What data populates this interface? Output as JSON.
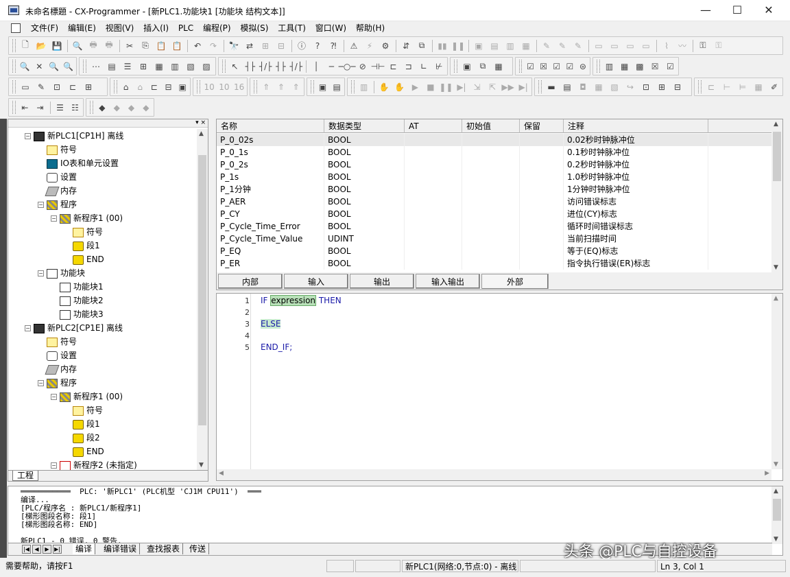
{
  "window": {
    "title": "未命名標題 - CX-Programmer - [新PLC1.功能块1 [功能块 结构文本]]",
    "minimize": "—",
    "maximize": "☐",
    "close": "✕"
  },
  "menu": [
    "文件(F)",
    "编辑(E)",
    "视图(V)",
    "插入(I)",
    "PLC",
    "编程(P)",
    "模拟(S)",
    "工具(T)",
    "窗口(W)",
    "帮助(H)"
  ],
  "mdi_controls": {
    "minimize": "–",
    "restore": "▫",
    "close": "×"
  },
  "tree": {
    "items": [
      {
        "label": "新PLC1[CP1H] 离线",
        "icon": "plc-icon",
        "level": 0,
        "expander": "−"
      },
      {
        "label": "符号",
        "icon": "symbols-icon",
        "level": 1
      },
      {
        "label": "IO表和单元设置",
        "icon": "io-table-icon",
        "level": 1
      },
      {
        "label": "设置",
        "icon": "settings-icon",
        "level": 1
      },
      {
        "label": "内存",
        "icon": "memory-icon",
        "level": 1
      },
      {
        "label": "程序",
        "icon": "programs-icon",
        "level": 1,
        "expander": "−"
      },
      {
        "label": "新程序1 (00)",
        "icon": "program-icon",
        "level": 2,
        "expander": "−"
      },
      {
        "label": "符号",
        "icon": "symbols-icon",
        "level": 3
      },
      {
        "label": "段1",
        "icon": "section-icon",
        "level": 3
      },
      {
        "label": "END",
        "icon": "section-icon",
        "level": 3
      },
      {
        "label": "功能块",
        "icon": "function-blocks-icon",
        "level": 1,
        "expander": "−"
      },
      {
        "label": "功能块1",
        "icon": "function-block-icon",
        "level": 2
      },
      {
        "label": "功能块2",
        "icon": "function-block-icon",
        "level": 2
      },
      {
        "label": "功能块3",
        "icon": "function-block-icon",
        "level": 2
      },
      {
        "label": "新PLC2[CP1E] 离线",
        "icon": "plc-icon",
        "level": 0,
        "expander": "−"
      },
      {
        "label": "符号",
        "icon": "symbols-icon",
        "level": 1
      },
      {
        "label": "设置",
        "icon": "settings-icon",
        "level": 1
      },
      {
        "label": "内存",
        "icon": "memory-icon",
        "level": 1
      },
      {
        "label": "程序",
        "icon": "programs-icon",
        "level": 1,
        "expander": "−"
      },
      {
        "label": "新程序1 (00)",
        "icon": "program-icon",
        "level": 2,
        "expander": "−"
      },
      {
        "label": "符号",
        "icon": "symbols-icon",
        "level": 3
      },
      {
        "label": "段1",
        "icon": "section-icon",
        "level": 3
      },
      {
        "label": "段2",
        "icon": "section-icon",
        "level": 3
      },
      {
        "label": "END",
        "icon": "section-icon",
        "level": 3
      },
      {
        "label": "新程序2 (未指定)",
        "icon": "program-unassigned-icon",
        "level": 2,
        "expander": "−"
      }
    ],
    "tab": "工程"
  },
  "variables": {
    "columns": [
      "名称",
      "数据类型",
      "AT",
      "初始值",
      "保留",
      "注释"
    ],
    "rows": [
      [
        "P_0_02s",
        "BOOL",
        "",
        "",
        "",
        "0.02秒时钟脉冲位"
      ],
      [
        "P_0_1s",
        "BOOL",
        "",
        "",
        "",
        "0.1秒时钟脉冲位"
      ],
      [
        "P_0_2s",
        "BOOL",
        "",
        "",
        "",
        "0.2秒时钟脉冲位"
      ],
      [
        "P_1s",
        "BOOL",
        "",
        "",
        "",
        "1.0秒时钟脉冲位"
      ],
      [
        "P_1分钟",
        "BOOL",
        "",
        "",
        "",
        "1分钟时钟脉冲位"
      ],
      [
        "P_AER",
        "BOOL",
        "",
        "",
        "",
        "访问错误标志"
      ],
      [
        "P_CY",
        "BOOL",
        "",
        "",
        "",
        "进位(CY)标志"
      ],
      [
        "P_Cycle_Time_Error",
        "BOOL",
        "",
        "",
        "",
        "循环时间错误标志"
      ],
      [
        "P_Cycle_Time_Value",
        "UDINT",
        "",
        "",
        "",
        "当前扫描时间"
      ],
      [
        "P_EQ",
        "BOOL",
        "",
        "",
        "",
        "等于(EQ)标志"
      ],
      [
        "P_ER",
        "BOOL",
        "",
        "",
        "",
        "指令执行错误(ER)标志"
      ]
    ],
    "tabs": [
      "内部",
      "输入",
      "输出",
      "输入输出",
      "外部"
    ],
    "active_tab": "外部"
  },
  "editor": {
    "lines": [
      {
        "n": "1",
        "kw1": "IF",
        "expr": "expression",
        "kw2": "THEN"
      },
      {
        "n": "2"
      },
      {
        "n": "3",
        "kw1": "ELSE"
      },
      {
        "n": "4"
      },
      {
        "n": "5",
        "kw1": "END_IF;"
      }
    ]
  },
  "output": {
    "lines": [
      "═══════════  PLC: '新PLC1' (PLC机型 'CJ1M CPU11')  ═══",
      "编译...",
      "[PLC/程序名 : 新PLC1/新程序1]",
      "[梯形图段名称: 段1]",
      "[梯形图段名称: END]",
      "",
      "新PLC1 - 0 错误, 0 警告."
    ],
    "tabs": [
      "编译",
      "编译错误",
      "查找报表",
      "传送"
    ],
    "active_tab": "编译"
  },
  "watermark": "头条 @PLC与自控设备",
  "status": {
    "help": "需要帮助，请按F1",
    "plc": "新PLC1(网络:0,节点:0) - 离线",
    "position": "Ln 3, Col 1"
  }
}
